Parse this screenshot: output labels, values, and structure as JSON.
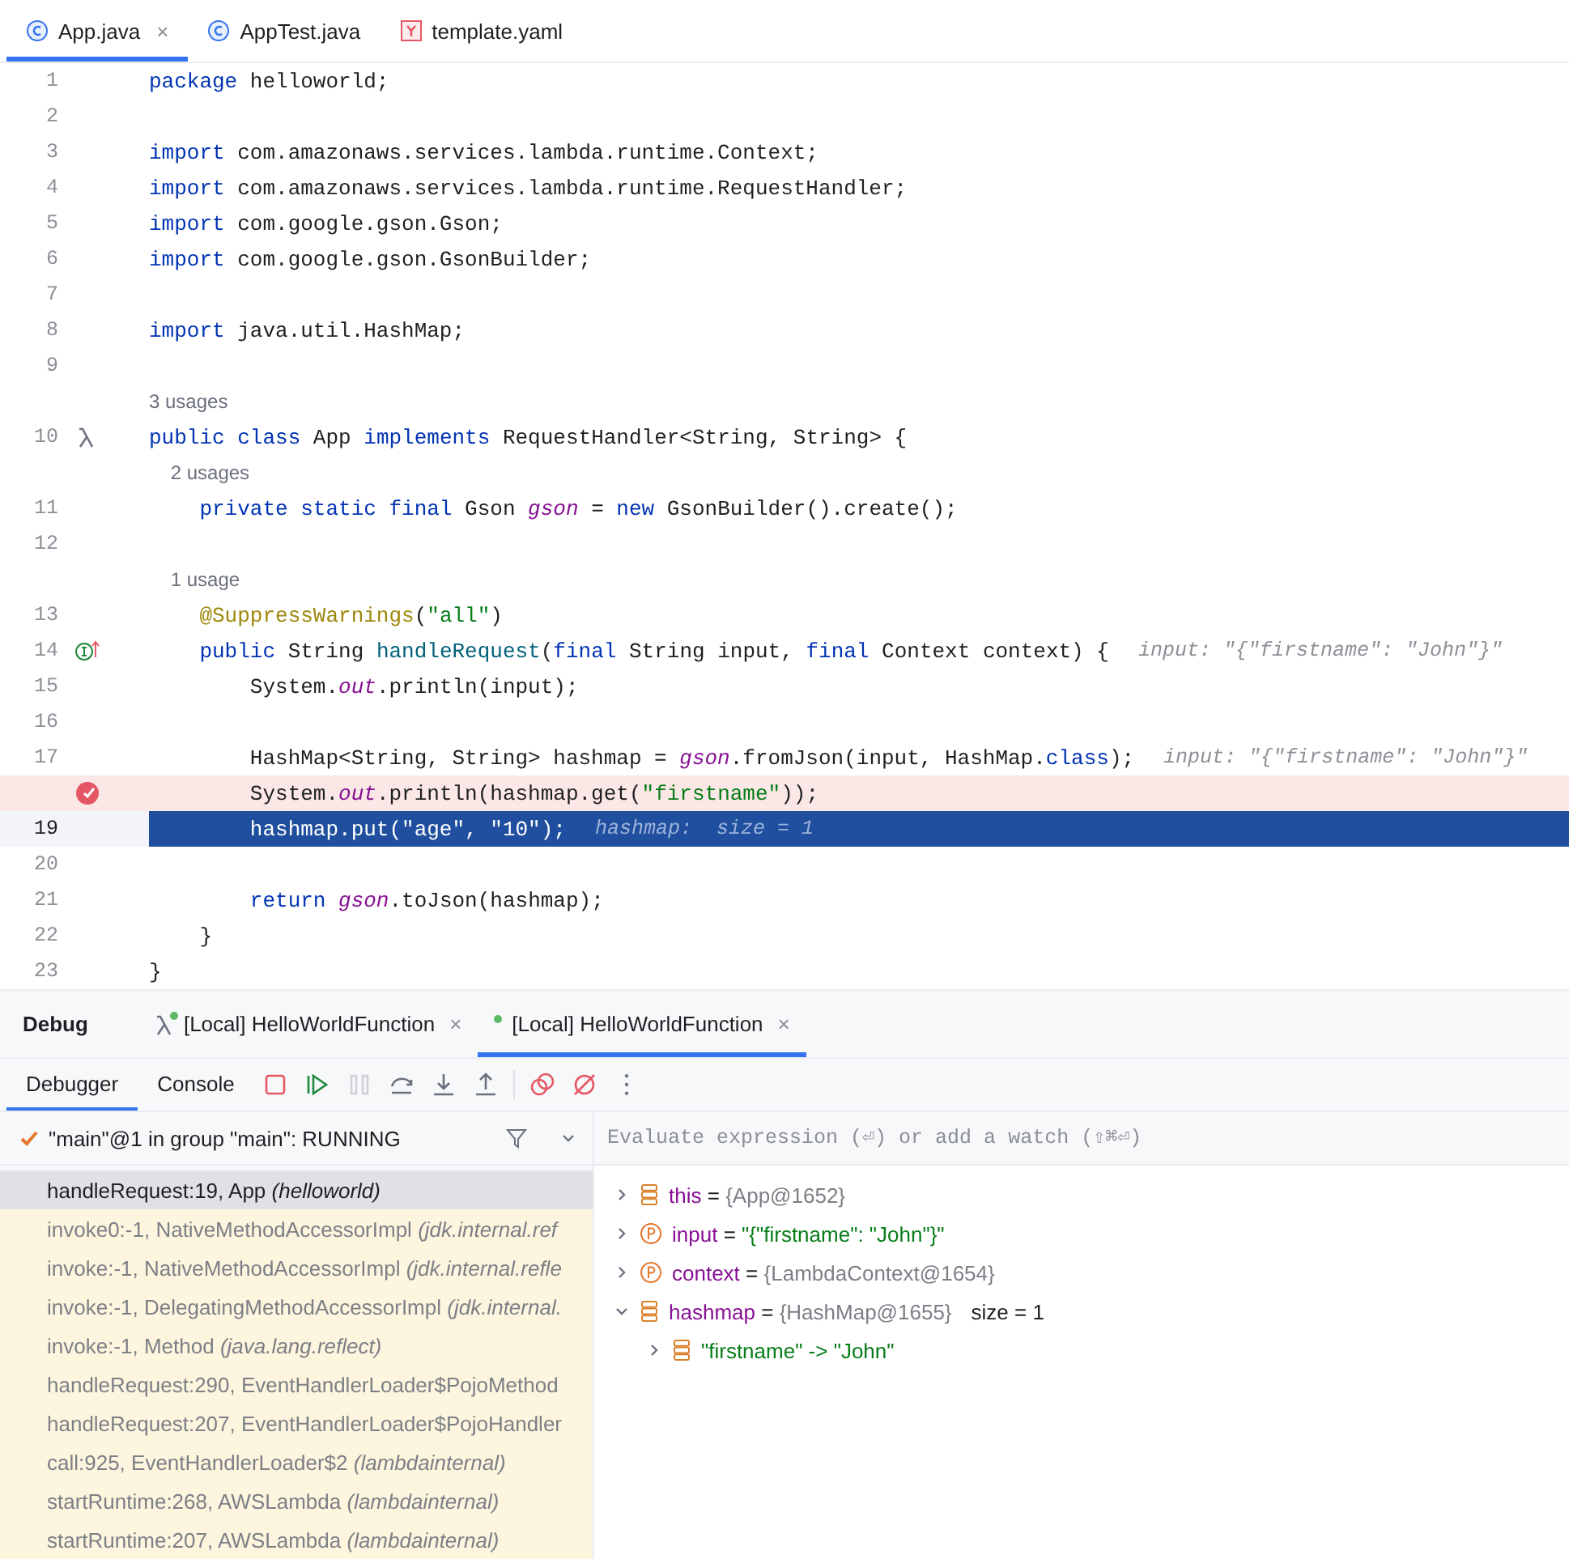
{
  "file_tabs": [
    {
      "label": "App.java",
      "kind": "class",
      "selected": true,
      "close": "×"
    },
    {
      "label": "AppTest.java",
      "kind": "class",
      "selected": false
    },
    {
      "label": "template.yaml",
      "kind": "yaml",
      "selected": false
    }
  ],
  "editor": {
    "lines": [
      {
        "number": "1",
        "breakpoint": false,
        "current": false,
        "tokens": [
          {
            "kind": "keyword",
            "text": "package"
          },
          {
            "kind": "plain",
            "text": " helloworld;"
          }
        ]
      },
      {
        "number": "2",
        "breakpoint": false,
        "current": false
      },
      {
        "number": "3",
        "breakpoint": false,
        "current": false,
        "tokens": [
          {
            "kind": "keyword",
            "text": "import"
          },
          {
            "kind": "plain",
            "text": " com.amazonaws.services.lambda.runtime.Context;"
          }
        ]
      },
      {
        "number": "4",
        "breakpoint": false,
        "current": false,
        "tokens": [
          {
            "kind": "keyword",
            "text": "import"
          },
          {
            "kind": "plain",
            "text": " com.amazonaws.services.lambda.runtime.RequestHandler;"
          }
        ]
      },
      {
        "number": "5",
        "breakpoint": false,
        "current": false,
        "tokens": [
          {
            "kind": "keyword",
            "text": "import"
          },
          {
            "kind": "plain",
            "text": " com.google.gson.Gson;"
          }
        ]
      },
      {
        "number": "6",
        "breakpoint": false,
        "current": false,
        "tokens": [
          {
            "kind": "keyword",
            "text": "import"
          },
          {
            "kind": "plain",
            "text": " com.google.gson.GsonBuilder;"
          }
        ]
      },
      {
        "number": "7",
        "breakpoint": false,
        "current": false
      },
      {
        "number": "8",
        "breakpoint": false,
        "current": false,
        "tokens": [
          {
            "kind": "keyword",
            "text": "import"
          },
          {
            "kind": "plain",
            "text": " java.util.HashMap;"
          }
        ]
      },
      {
        "number": "9",
        "breakpoint": false,
        "current": false
      },
      {
        "number": "10",
        "usages": "3 usages",
        "gutter": {
          "kind": "lambda"
        },
        "breakpoint": false,
        "current": false,
        "tokens": [
          {
            "kind": "keyword",
            "text": "public class"
          },
          {
            "kind": "plain",
            "text": " App "
          },
          {
            "kind": "keyword",
            "text": "implements"
          },
          {
            "kind": "plain",
            "text": " RequestHandler<String, String> {"
          }
        ]
      },
      {
        "number": "11",
        "usages": "2 usages",
        "breakpoint": false,
        "current": false,
        "tokens": [
          {
            "kind": "keyword",
            "text": "    private static final"
          },
          {
            "kind": "plain",
            "text": " Gson "
          },
          {
            "kind": "field",
            "text": "gson"
          },
          {
            "kind": "plain",
            "text": " = "
          },
          {
            "kind": "keyword",
            "text": "new"
          },
          {
            "kind": "plain",
            "text": " GsonBuilder().create();"
          }
        ]
      },
      {
        "number": "12",
        "breakpoint": false,
        "current": false
      },
      {
        "number": "13",
        "usages": "1 usage",
        "breakpoint": false,
        "current": false,
        "tokens": [
          {
            "kind": "annotation",
            "text": "    @SuppressWarnings"
          },
          {
            "kind": "plain",
            "text": "("
          },
          {
            "kind": "string",
            "text": "\"all\""
          },
          {
            "kind": "plain",
            "text": ")"
          }
        ]
      },
      {
        "number": "14",
        "gutter": {
          "kind": "implements"
        },
        "breakpoint": false,
        "current": false,
        "hint": "input: \"{\"firstname\": \"John\"}\"",
        "tokens": [
          {
            "kind": "keyword",
            "text": "    public"
          },
          {
            "kind": "plain",
            "text": " String "
          },
          {
            "kind": "method",
            "text": "handleRequest"
          },
          {
            "kind": "plain",
            "text": "("
          },
          {
            "kind": "keyword",
            "text": "final"
          },
          {
            "kind": "plain",
            "text": " String input, "
          },
          {
            "kind": "keyword",
            "text": "final"
          },
          {
            "kind": "plain",
            "text": " Context context) {"
          }
        ]
      },
      {
        "number": "15",
        "breakpoint": false,
        "current": false,
        "tokens": [
          {
            "kind": "plain",
            "text": "        System."
          },
          {
            "kind": "field",
            "text": "out"
          },
          {
            "kind": "plain",
            "text": ".println(input);"
          }
        ]
      },
      {
        "number": "16",
        "breakpoint": false,
        "current": false
      },
      {
        "number": "17",
        "breakpoint": false,
        "current": false,
        "hint": "input: \"{\"firstname\": \"John\"}\"",
        "tokens": [
          {
            "kind": "plain",
            "text": "        HashMap<String, String> hashmap = "
          },
          {
            "kind": "field",
            "text": "gson"
          },
          {
            "kind": "plain",
            "text": ".fromJson(input, HashMap."
          },
          {
            "kind": "keyword",
            "text": "class"
          },
          {
            "kind": "plain",
            "text": ");"
          }
        ]
      },
      {
        "breakpoint": true,
        "current": false,
        "tokens": [
          {
            "kind": "plain",
            "text": "        System."
          },
          {
            "kind": "field",
            "text": "out"
          },
          {
            "kind": "plain",
            "text": ".println(hashmap.get("
          },
          {
            "kind": "string",
            "text": "\"firstname\""
          },
          {
            "kind": "plain",
            "text": "));"
          }
        ]
      },
      {
        "number": "19",
        "breakpoint": false,
        "current": true,
        "hint": "hashmap:  size = 1",
        "tokens": [
          {
            "kind": "plain",
            "text": "        hashmap.put("
          },
          {
            "kind": "string",
            "text": "\"age\""
          },
          {
            "kind": "plain",
            "text": ", "
          },
          {
            "kind": "string",
            "text": "\"10\""
          },
          {
            "kind": "plain",
            "text": ");"
          }
        ]
      },
      {
        "number": "20",
        "breakpoint": false,
        "current": false
      },
      {
        "number": "21",
        "breakpoint": false,
        "current": false,
        "tokens": [
          {
            "kind": "keyword",
            "text": "        return "
          },
          {
            "kind": "field",
            "text": "gson"
          },
          {
            "kind": "plain",
            "text": ".toJson(hashmap);"
          }
        ]
      },
      {
        "number": "22",
        "breakpoint": false,
        "current": false,
        "tokens": [
          {
            "kind": "plain",
            "text": "    }"
          }
        ]
      },
      {
        "number": "23",
        "breakpoint": false,
        "current": false,
        "tokens": [
          {
            "kind": "plain",
            "text": "}"
          }
        ]
      }
    ]
  },
  "debug": {
    "title": "Debug",
    "tabs": [
      {
        "label": "[Local] HelloWorldFunction",
        "kind": "lambda",
        "selected": false,
        "close": "×"
      },
      {
        "label": "[Local] HelloWorldFunction",
        "kind": "plain",
        "selected": true,
        "close": "×"
      }
    ],
    "subtabs": [
      {
        "label": "Debugger",
        "selected": true
      },
      {
        "label": "Console",
        "selected": false
      }
    ],
    "tools": [
      {
        "kind": "stop",
        "disabled": false
      },
      {
        "kind": "resume",
        "disabled": false
      },
      {
        "kind": "pause",
        "disabled": true
      },
      {
        "kind": "step-over",
        "disabled": false
      },
      {
        "kind": "step-into",
        "disabled": false
      },
      {
        "kind": "step-out",
        "disabled": false
      },
      {
        "kind": "separator"
      },
      {
        "kind": "breakpoints",
        "disabled": false
      },
      {
        "kind": "mute",
        "disabled": false
      },
      {
        "kind": "more",
        "disabled": false
      }
    ],
    "thread": "\"main\"@1 in group \"main\": RUNNING",
    "frames": [
      {
        "method": "handleRequest:19, App",
        "package": "(helloworld)",
        "library": false,
        "selected": true
      },
      {
        "method": "invoke0:-1, NativeMethodAccessorImpl",
        "package": "(jdk.internal.ref",
        "library": true,
        "selected": false
      },
      {
        "method": "invoke:-1, NativeMethodAccessorImpl",
        "package": "(jdk.internal.refle",
        "library": true,
        "selected": false
      },
      {
        "method": "invoke:-1, DelegatingMethodAccessorImpl",
        "package": "(jdk.internal.",
        "library": true,
        "selected": false
      },
      {
        "method": "invoke:-1, Method",
        "package": "(java.lang.reflect)",
        "library": true,
        "selected": false
      },
      {
        "method": "handleRequest:290, EventHandlerLoader$PojoMethod",
        "library": true,
        "selected": false
      },
      {
        "method": "handleRequest:207, EventHandlerLoader$PojoHandler",
        "library": true,
        "selected": false
      },
      {
        "method": "call:925, EventHandlerLoader$2",
        "package": "(lambdainternal)",
        "library": true,
        "selected": false
      },
      {
        "method": "startRuntime:268, AWSLambda",
        "package": "(lambdainternal)",
        "library": true,
        "selected": false
      },
      {
        "method": "startRuntime:207, AWSLambda",
        "package": "(lambdainternal)",
        "library": true,
        "selected": false
      }
    ],
    "evaluate": {
      "placeholder": "Evaluate expression (⏎) or add a watch (⇧⌘⏎)"
    },
    "variables": [
      {
        "kind": "field",
        "name": "this",
        "operator": "=",
        "value": "{App@1652}",
        "expanded": false
      },
      {
        "kind": "param",
        "name": "input",
        "operator": "=",
        "string_value": "\"{\"firstname\": \"John\"}\"",
        "expanded": false
      },
      {
        "kind": "param",
        "name": "context",
        "operator": "=",
        "value": "{LambdaContext@1654}",
        "expanded": false
      },
      {
        "kind": "field",
        "name": "hashmap",
        "operator": "=",
        "value": "{HashMap@1655}",
        "note": "size = 1",
        "expanded": true,
        "children": [
          {
            "kind": "field",
            "entry": "\"firstname\" -> \"John\"",
            "expanded": false
          }
        ]
      }
    ]
  }
}
